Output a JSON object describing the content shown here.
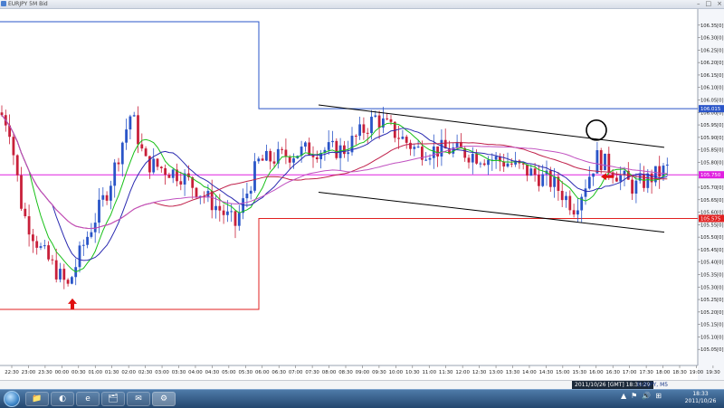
{
  "window": {
    "title": "EURJPY 5M Bid",
    "controls": [
      "–",
      "□",
      "×"
    ]
  },
  "chart_data": {
    "type": "candlestick",
    "symbol": "EURJPY",
    "timeframe": "5M",
    "price_type": "Bid",
    "y_axis": {
      "min": 105.0,
      "max": 106.4,
      "ticks": [
        "106.35[0]",
        "106.30[0]",
        "106.25[0]",
        "106.20[0]",
        "106.15[0]",
        "106.10[0]",
        "106.05[0]",
        "106.00[0]",
        "105.95[0]",
        "105.90[0]",
        "105.85[0]",
        "105.80[0]",
        "105.75[0]",
        "105.70[0]",
        "105.65[0]",
        "105.60[0]",
        "105.55[0]",
        "105.50[0]",
        "105.45[0]",
        "105.40[0]",
        "105.35[0]",
        "105.30[0]",
        "105.25[0]",
        "105.20[0]",
        "105.15[0]",
        "105.10[0]",
        "105.05[0]"
      ],
      "tick_values": [
        106.35,
        106.3,
        106.25,
        106.2,
        106.15,
        106.1,
        106.05,
        106.0,
        105.95,
        105.9,
        105.85,
        105.8,
        105.75,
        105.7,
        105.65,
        105.6,
        105.55,
        105.5,
        105.45,
        105.4,
        105.35,
        105.3,
        105.25,
        105.2,
        105.15,
        105.1,
        105.05
      ]
    },
    "x_axis": {
      "labels": [
        "22:30",
        "23:00",
        "23:30",
        "00:00",
        "00:30",
        "01:00",
        "01:30",
        "02:00",
        "02:30",
        "03:00",
        "03:30",
        "04:00",
        "04:30",
        "05:00",
        "05:30",
        "06:00",
        "06:30",
        "07:00",
        "07:30",
        "08:00",
        "08:30",
        "09:00",
        "09:30",
        "10:00",
        "10:30",
        "11:00",
        "11:30",
        "12:00",
        "12:30",
        "13:00",
        "13:30",
        "14:00",
        "14:30",
        "15:00",
        "15:30",
        "16:00",
        "16:30",
        "17:00",
        "17:30",
        "18:00",
        "18:30",
        "19:00",
        "19:30"
      ],
      "note": "the third–fifth labels print as 23:30, 00:00 (shown as 10.26 date marker), 00:30 on the screenshot"
    },
    "price_labels": [
      {
        "value": "106.015",
        "price": 106.015,
        "color": "#2a55c8"
      },
      {
        "value": "105.750",
        "price": 105.75,
        "color": "#e020e0"
      },
      {
        "value": "105.575",
        "price": 105.575,
        "color": "#e02020"
      }
    ],
    "levels": [
      {
        "name": "previous-high-box",
        "price": 106.015,
        "color": "#2a55c8"
      },
      {
        "name": "current-bid",
        "price": 105.75,
        "color": "#e020e0"
      },
      {
        "name": "previous-low-box",
        "price": 105.575,
        "color": "#e02020"
      }
    ],
    "channel": {
      "upper": [
        [
          0,
          106.03
        ],
        [
          1,
          105.86
        ]
      ],
      "lower": [
        [
          0,
          105.68
        ],
        [
          1,
          105.52
        ]
      ]
    },
    "annotations": [
      {
        "type": "arrow-up",
        "color": "#e01010",
        "near_label": "00:30",
        "price": 105.24
      },
      {
        "type": "arrow-left",
        "color": "#e01010",
        "near_label": "16:30",
        "price": 105.75
      },
      {
        "type": "circle",
        "color": "#000000",
        "near_label": "16:00",
        "price": 105.9
      }
    ],
    "moving_averages": [
      {
        "color": "#2a2ab0",
        "type": "fast-ma"
      },
      {
        "color": "#18c018",
        "type": "medium-ma"
      },
      {
        "color": "#c0204a",
        "type": "slow-ma"
      },
      {
        "color": "#c050c0",
        "type": "long-ma"
      }
    ]
  },
  "status_bar": {
    "timezone_label": "2011/10/26 [GMT] 18:33:29",
    "symbol_info": "EURJPY, M5"
  },
  "taskbar": {
    "buttons": [
      "📁",
      "◐",
      "e",
      "🗂",
      "✉",
      "⚙",
      "★"
    ],
    "clock_time": "18:33",
    "clock_date": "2011/10/26",
    "tray_icons": [
      "▲",
      "⚑",
      "🔊",
      "⊞"
    ]
  }
}
